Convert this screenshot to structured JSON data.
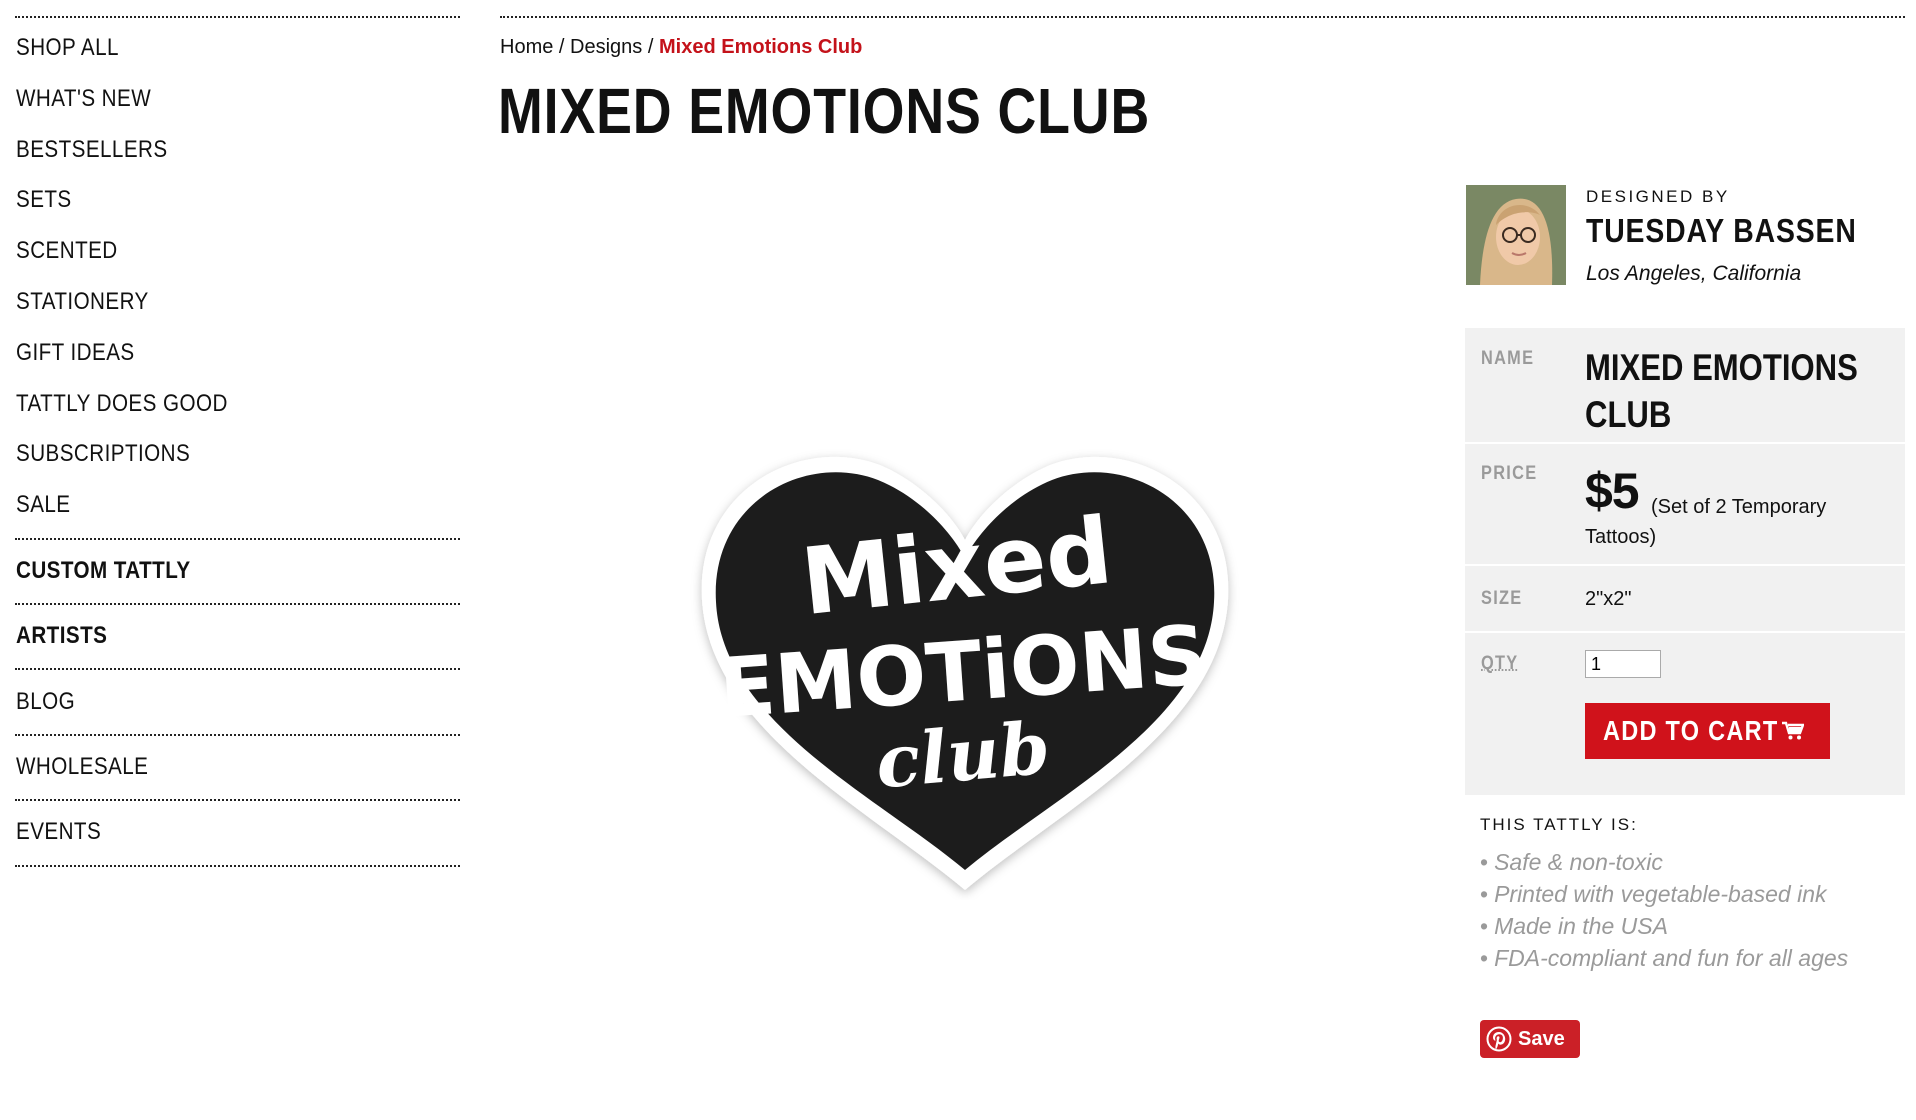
{
  "sidebar": {
    "items": [
      {
        "label": "SHOP ALL"
      },
      {
        "label": "WHAT'S NEW"
      },
      {
        "label": "BESTSELLERS"
      },
      {
        "label": "SETS"
      },
      {
        "label": "SCENTED"
      },
      {
        "label": "STATIONERY"
      },
      {
        "label": "GIFT IDEAS"
      },
      {
        "label": "TATTLY DOES GOOD"
      },
      {
        "label": "SUBSCRIPTIONS"
      },
      {
        "label": "SALE"
      }
    ],
    "sections": [
      {
        "label": "CUSTOM TATTLY"
      },
      {
        "label": "ARTISTS"
      },
      {
        "label": "BLOG"
      },
      {
        "label": "WHOLESALE"
      },
      {
        "label": "EVENTS"
      }
    ]
  },
  "breadcrumb": {
    "home": "Home",
    "sep": "/",
    "designs": "Designs",
    "current": "Mixed Emotions Club"
  },
  "page": {
    "title": "MIXED EMOTIONS CLUB"
  },
  "product_art": {
    "line1": "Mixed",
    "line2": "EMOTiONS",
    "line3": "club"
  },
  "designer": {
    "heading": "DESIGNED BY",
    "name": "TUESDAY BASSEN",
    "location": "Los Angeles, California"
  },
  "details": {
    "name_label": "NAME",
    "name_value": "MIXED EMOTIONS CLUB",
    "price_label": "PRICE",
    "price_value": "$5",
    "price_note": "(Set of 2 Temporary Tattoos)",
    "size_label": "SIZE",
    "size_value": "2\"x2\"",
    "qty_label": "QTY",
    "qty_value": "1",
    "cart_label": "ADD TO CART"
  },
  "tattly_is": {
    "heading": "THIS TATTLY IS:",
    "features": [
      "Safe & non-toxic",
      "Printed with vegetable-based ink",
      "Made in the USA",
      "FDA-compliant and fun for all ages"
    ]
  },
  "pinterest": {
    "label": "Save"
  },
  "colors": {
    "accent": "#d0121b",
    "breadcrumb_current": "#c4121a",
    "muted": "#9a9a9a",
    "panel": "#f1f1f1"
  },
  "icons": [
    "shopping-cart-icon",
    "pinterest-icon"
  ]
}
